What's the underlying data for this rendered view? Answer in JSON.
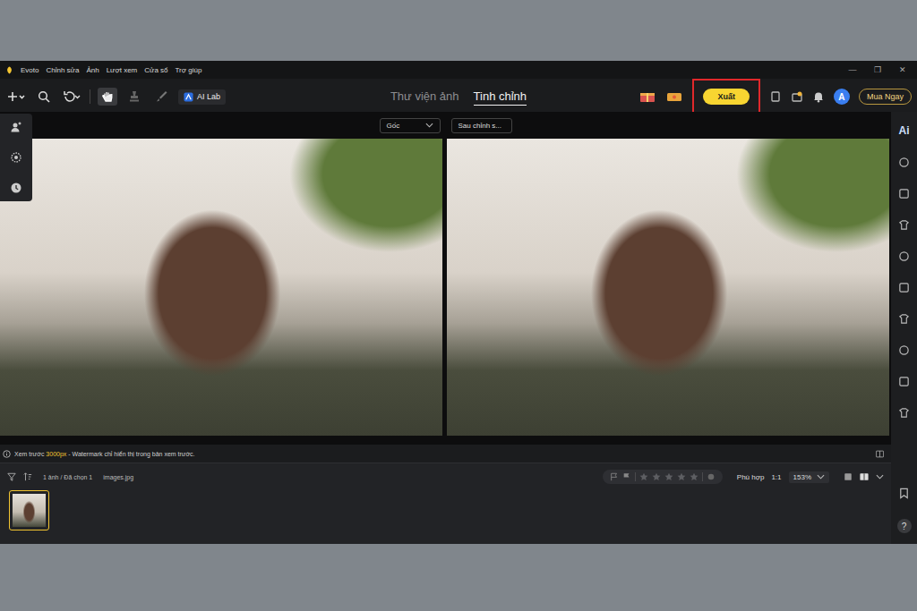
{
  "titlebar": {
    "app_name": "Evoto",
    "menu": [
      "Chỉnh sửa",
      "Ảnh",
      "Lượt xem",
      "Cửa sổ",
      "Trợ giúp"
    ],
    "controls": [
      "—",
      "❐",
      "✕"
    ]
  },
  "toolbar": {
    "tools": [
      {
        "selected": false
      },
      {
        "selected": false
      },
      {
        "selected": false
      },
      {
        "selected": true
      },
      {
        "selected": false
      },
      {
        "selected": false
      }
    ],
    "ai_lab": "AI Lab"
  },
  "tabs": [
    {
      "label": "Thư viện ảnh",
      "selected": false
    },
    {
      "label": "Tinh chỉnh",
      "selected": true
    }
  ],
  "export_button": {
    "label": "Xuất",
    "highlighted": true
  },
  "avatar": "A",
  "buy_button": "Mua Ngay",
  "compare": {
    "before": "Gốc",
    "after": "Sau chỉnh s..."
  },
  "preview_note": {
    "prefix": "Xem trước ",
    "size": "3000px",
    "suffix": " - Watermark chỉ hiển thị trong bản xem trước."
  },
  "filmstrip": {
    "count": "1 ảnh / Đã chọn 1",
    "filename": "images.jpg",
    "stars": 0,
    "fit": "Phù hợp",
    "ratio": "1:1",
    "zoom": "153%",
    "thumbnails": [
      {
        "selected": true
      }
    ]
  },
  "right_sidebar": {
    "ai_label": "Ai"
  },
  "help": "?"
}
